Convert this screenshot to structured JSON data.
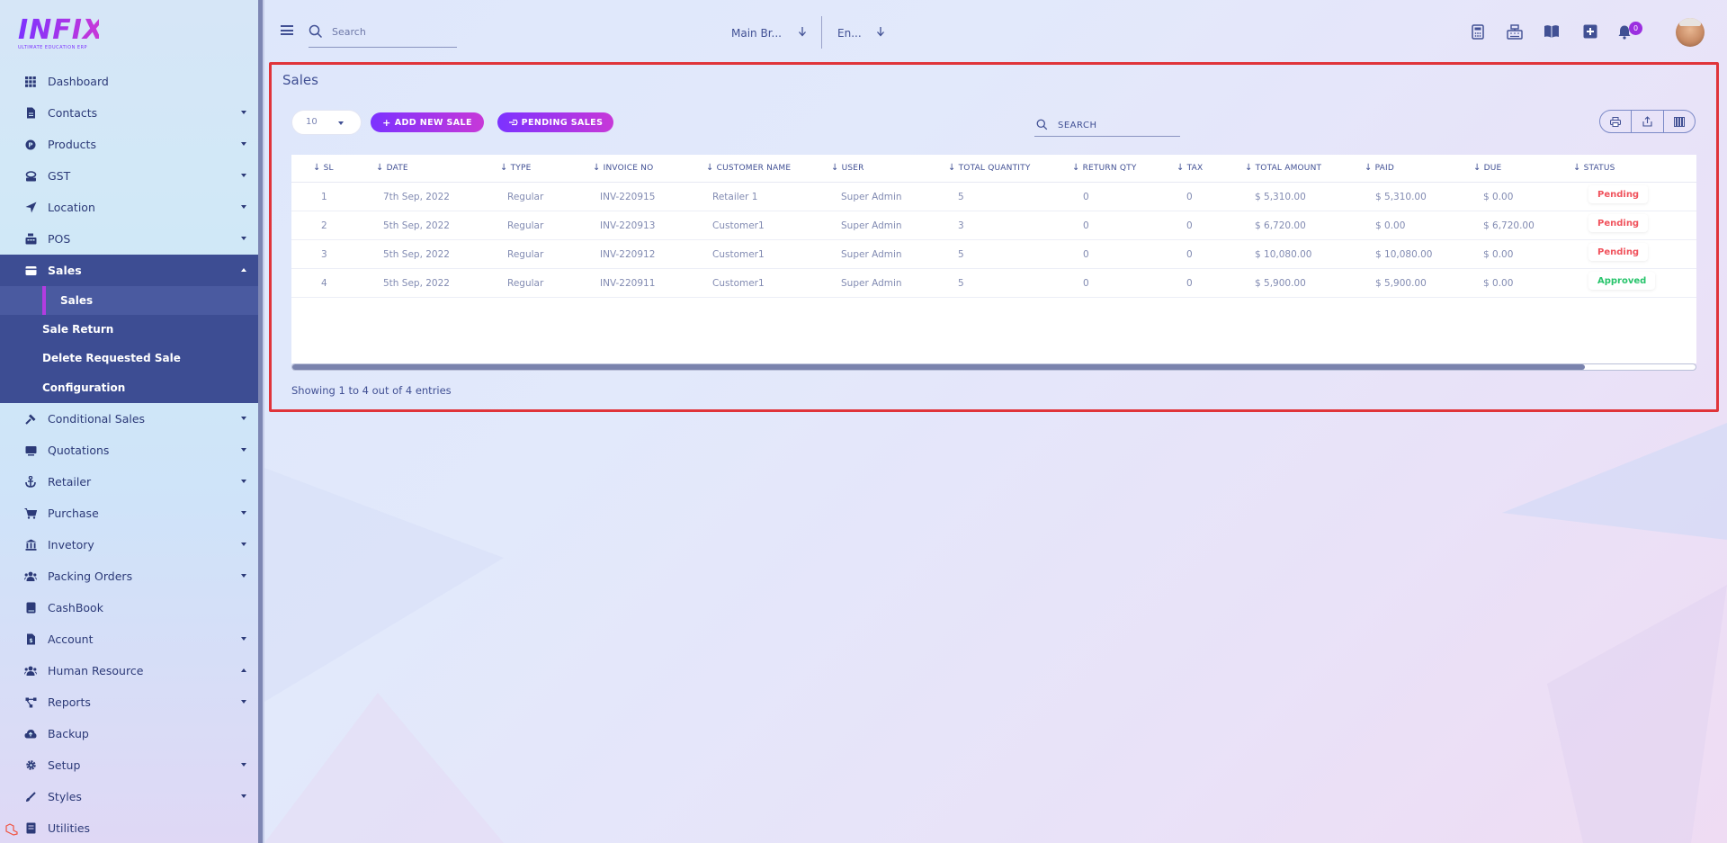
{
  "brand": {
    "logo": "INFIX",
    "tagline": "ULTIMATE EDUCATION ERP"
  },
  "sidebar": {
    "items_top": [
      {
        "label": "Dashboard",
        "icon": "grid-icon",
        "caret": "none"
      },
      {
        "label": "Contacts",
        "icon": "contacts-icon",
        "caret": "down"
      },
      {
        "label": "Products",
        "icon": "products-icon",
        "caret": "down"
      },
      {
        "label": "GST",
        "icon": "gst-icon",
        "caret": "down"
      },
      {
        "label": "Location",
        "icon": "location-icon",
        "caret": "down"
      },
      {
        "label": "POS",
        "icon": "pos-icon",
        "caret": "down"
      }
    ],
    "active_group": {
      "label": "Sales",
      "icon": "sales-icon",
      "children": [
        "Sales",
        "Sale Return",
        "Delete Requested Sale",
        "Configuration"
      ]
    },
    "items_bottom": [
      {
        "label": "Conditional Sales",
        "icon": "hammer-icon",
        "caret": "down"
      },
      {
        "label": "Quotations",
        "icon": "quotation-icon",
        "caret": "down"
      },
      {
        "label": "Retailer",
        "icon": "retailer-icon",
        "caret": "down"
      },
      {
        "label": "Purchase",
        "icon": "purchase-icon",
        "caret": "down"
      },
      {
        "label": "Invetory",
        "icon": "inventory-icon",
        "caret": "down"
      },
      {
        "label": "Packing Orders",
        "icon": "users-icon",
        "caret": "down"
      },
      {
        "label": "CashBook",
        "icon": "book-icon",
        "caret": "none"
      },
      {
        "label": "Account",
        "icon": "account-icon",
        "caret": "down"
      },
      {
        "label": "Human Resource",
        "icon": "users-icon",
        "caret": "up"
      },
      {
        "label": "Reports",
        "icon": "reports-icon",
        "caret": "down"
      },
      {
        "label": "Backup",
        "icon": "cloud-icon",
        "caret": "none"
      },
      {
        "label": "Setup",
        "icon": "gear-icon",
        "caret": "down"
      },
      {
        "label": "Styles",
        "icon": "brush-icon",
        "caret": "down"
      },
      {
        "label": "Utilities",
        "icon": "utilities-icon",
        "caret": "none"
      }
    ]
  },
  "topbar": {
    "search_placeholder": "Search",
    "branch": "Main Br...",
    "language": "En...",
    "notification_count": "0"
  },
  "main": {
    "title": "Sales",
    "per_page": "10",
    "add_button": "ADD NEW SALE",
    "pending_button": "PENDING SALES",
    "search_label": "SEARCH",
    "columns": [
      "SL",
      "DATE",
      "TYPE",
      "INVOICE NO",
      "CUSTOMER NAME",
      "USER",
      "TOTAL QUANTITY",
      "RETURN QTY",
      "TAX",
      "TOTAL AMOUNT",
      "PAID",
      "DUE",
      "STATUS"
    ],
    "rows": [
      {
        "sl": "1",
        "date": "7th Sep, 2022",
        "type": "Regular",
        "invoice": "INV-220915",
        "customer": "Retailer 1",
        "user": "Super Admin",
        "qty": "5",
        "return_qty": "0",
        "tax": "0",
        "total": "$ 5,310.00",
        "paid": "$ 5,310.00",
        "due": "$ 0.00",
        "status": "Pending"
      },
      {
        "sl": "2",
        "date": "5th Sep, 2022",
        "type": "Regular",
        "invoice": "INV-220913",
        "customer": "Customer1",
        "user": "Super Admin",
        "qty": "3",
        "return_qty": "0",
        "tax": "0",
        "total": "$ 6,720.00",
        "paid": "$ 0.00",
        "due": "$ 6,720.00",
        "status": "Pending"
      },
      {
        "sl": "3",
        "date": "5th Sep, 2022",
        "type": "Regular",
        "invoice": "INV-220912",
        "customer": "Customer1",
        "user": "Super Admin",
        "qty": "5",
        "return_qty": "0",
        "tax": "0",
        "total": "$ 10,080.00",
        "paid": "$ 10,080.00",
        "due": "$ 0.00",
        "status": "Pending"
      },
      {
        "sl": "4",
        "date": "5th Sep, 2022",
        "type": "Regular",
        "invoice": "INV-220911",
        "customer": "Customer1",
        "user": "Super Admin",
        "qty": "5",
        "return_qty": "0",
        "tax": "0",
        "total": "$ 5,900.00",
        "paid": "$ 5,900.00",
        "due": "$ 0.00",
        "status": "Approved"
      }
    ],
    "entries_info": "Showing 1 to 4 out of 4 entries"
  },
  "colors": {
    "accent_start": "#7c32ff",
    "accent_end": "#c738d8",
    "sidebar_active": "#3d4d93",
    "pending": "#f0525c",
    "approved": "#27c46b",
    "highlight_border": "#e0343a"
  }
}
